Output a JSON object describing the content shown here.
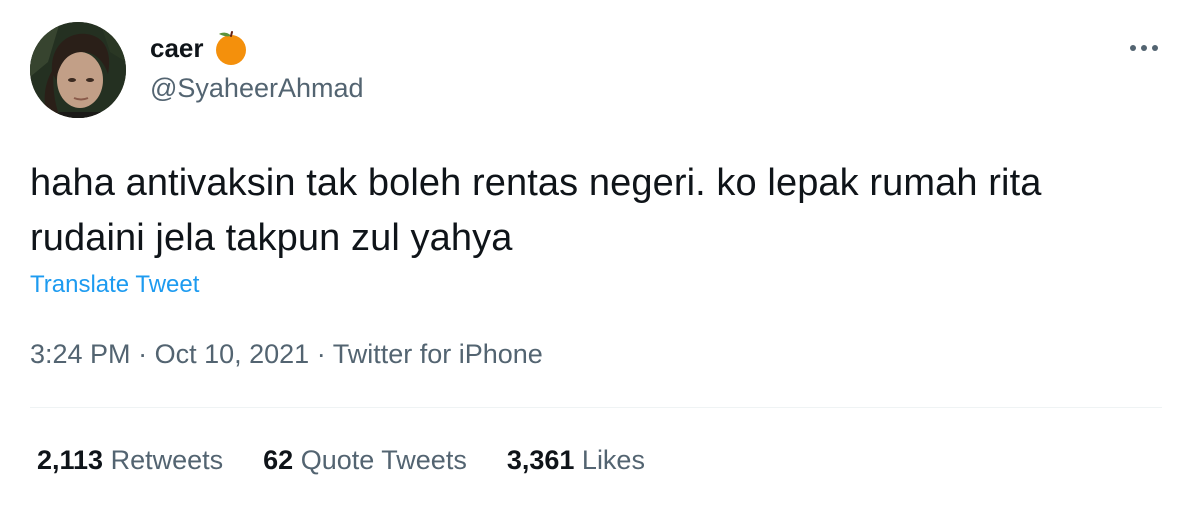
{
  "author": {
    "display_name": "caer",
    "emoji_icon": "orange-emoji-icon",
    "handle": "@SyaheerAhmad",
    "avatar_icon": "profile-photo"
  },
  "tweet": {
    "text": "haha antivaksin tak boleh rentas negeri. ko lepak rumah rita rudaini jela takpun zul yahya",
    "translate_label": "Translate Tweet",
    "time": "3:24 PM",
    "date": "Oct 10, 2021",
    "source": "Twitter for iPhone",
    "separator": "·"
  },
  "stats": {
    "retweets_count": "2,113",
    "retweets_label": "Retweets",
    "quote_count": "62",
    "quote_label": "Quote Tweets",
    "likes_count": "3,361",
    "likes_label": "Likes"
  },
  "colors": {
    "link": "#1d9bf0",
    "secondary_text": "#536471",
    "primary_text": "#0f1419",
    "divider": "#eff3f4",
    "emoji_orange": "#f4900c"
  }
}
